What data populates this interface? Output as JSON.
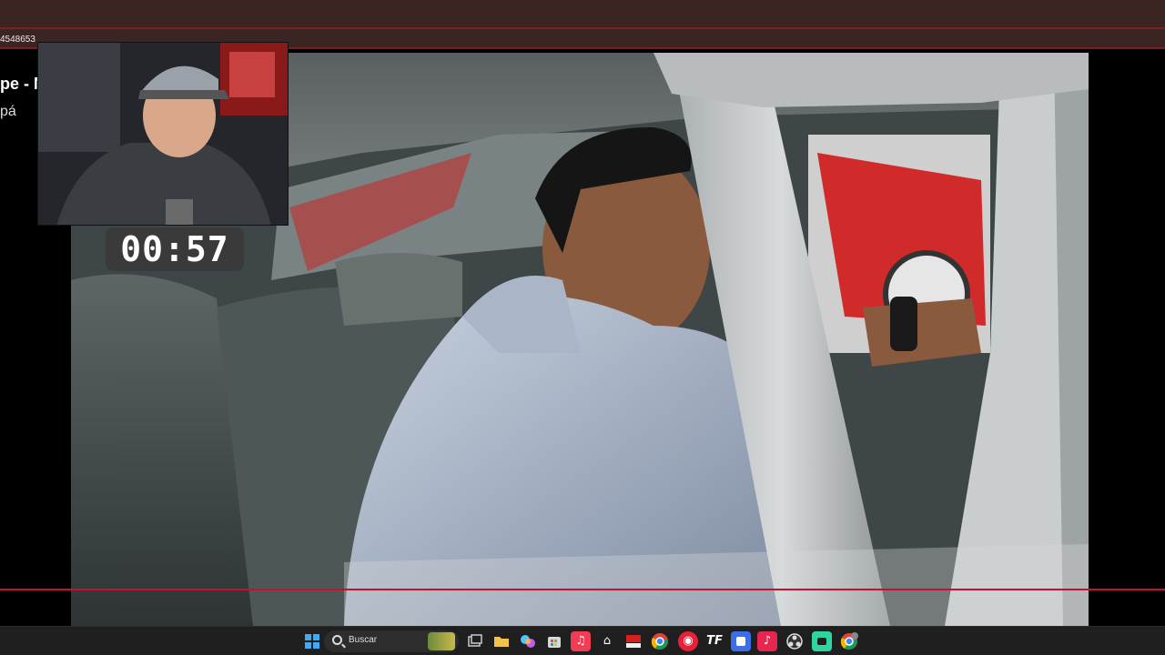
{
  "browser": {
    "address_fragment": "4548653"
  },
  "page": {
    "title_cut": "pe - N",
    "subtitle_cut": "pá"
  },
  "overlay": {
    "timer": "00:57"
  },
  "video": {
    "progress_color": "#c8102e"
  },
  "taskbar": {
    "search_placeholder": "Buscar",
    "icons": [
      "windows-start-icon",
      "search-icon",
      "task-view-icon",
      "file-explorer-icon",
      "copilot-icon",
      "microsoft-store-icon",
      "music-icon",
      "inbox-icon",
      "news-icon",
      "chrome-icon",
      "app-red-icon",
      "tf-app-icon",
      "blue-app-icon",
      "tiktok-icon",
      "obs-icon",
      "green-app-icon",
      "chrome-profile-icon"
    ]
  }
}
